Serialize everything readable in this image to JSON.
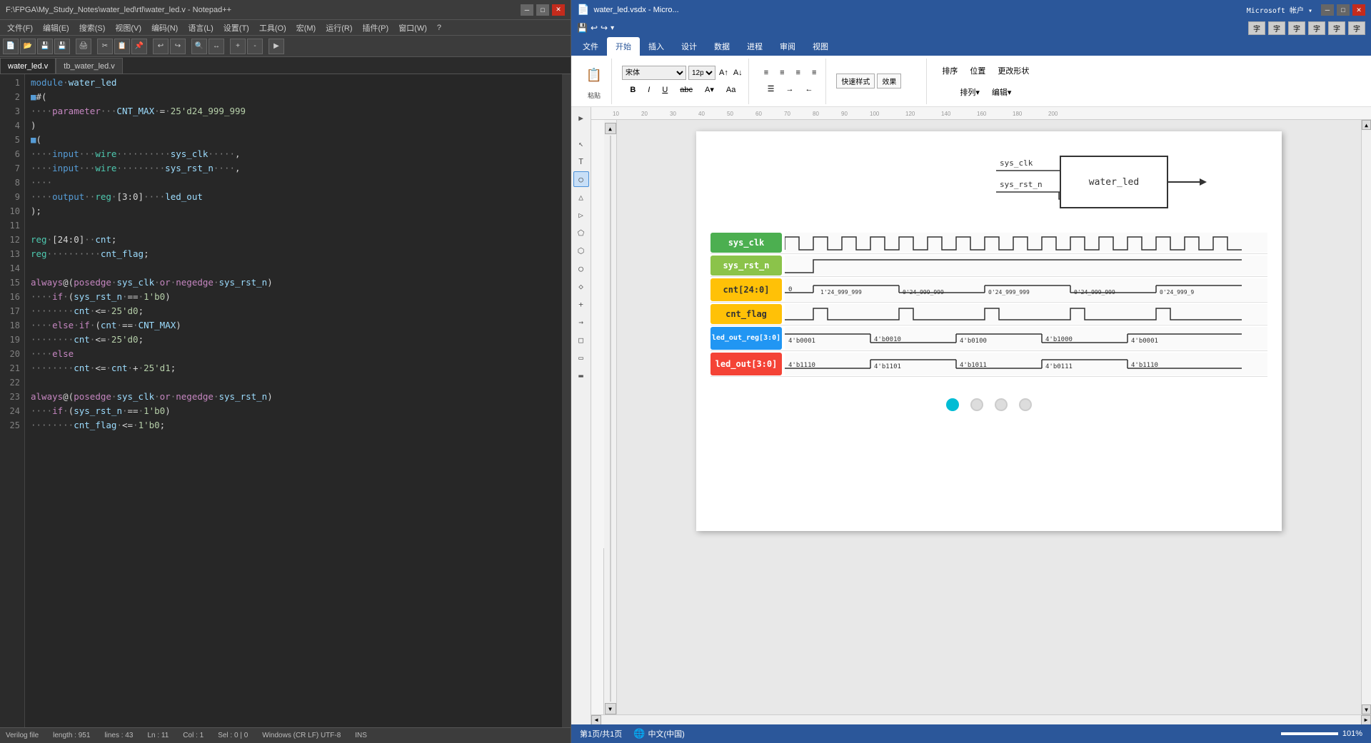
{
  "notepad": {
    "title": "F:\\FPGA\\My_Study_Notes\\water_led\\rtl\\water_led.v - Notepad++",
    "tabs": [
      {
        "label": "water_led.v",
        "active": true
      },
      {
        "label": "tb_water_led.v",
        "active": false
      }
    ],
    "menus": [
      "文件(F)",
      "编辑(E)",
      "搜索(S)",
      "视图(V)",
      "编码(N)",
      "语言(L)",
      "设置(T)",
      "工具(O)",
      "宏(M)",
      "运行(R)",
      "插件(P)",
      "窗口(W)",
      "?"
    ],
    "lines": [
      {
        "num": 1,
        "code": "module·water_led"
      },
      {
        "num": 2,
        "code": "#("
      },
      {
        "num": 3,
        "code": "····parameter···CNT_MAX·=·25'd24_999_999"
      },
      {
        "num": 4,
        "code": ")"
      },
      {
        "num": 5,
        "code": "("
      },
      {
        "num": 6,
        "code": "····input···wire··········sys_clk·····,"
      },
      {
        "num": 7,
        "code": "····input···wire·········sys_rst_n····,"
      },
      {
        "num": 8,
        "code": "····"
      },
      {
        "num": 9,
        "code": "····output··reg·[3:0]····led_out"
      },
      {
        "num": 10,
        "code": ");"
      },
      {
        "num": 11,
        "code": ""
      },
      {
        "num": 12,
        "code": "reg·[24:0]··cnt;"
      },
      {
        "num": 13,
        "code": "reg··········cnt_flag;"
      },
      {
        "num": 14,
        "code": ""
      },
      {
        "num": 15,
        "code": "always@(posedge·sys_clk·or·negedge·sys_rst_n)"
      },
      {
        "num": 16,
        "code": "····if·(sys_rst_n·==·1'b0)"
      },
      {
        "num": 17,
        "code": "········cnt·<=·25'd0;"
      },
      {
        "num": 18,
        "code": "····else·if·(cnt·==·CNT_MAX)"
      },
      {
        "num": 19,
        "code": "········cnt·<=·25'd0;"
      },
      {
        "num": 20,
        "code": "····else"
      },
      {
        "num": 21,
        "code": "········cnt·<=·cnt·+·25'd1;"
      },
      {
        "num": 22,
        "code": ""
      },
      {
        "num": 23,
        "code": "always@(posedge·sys_clk·or·negedge·sys_rst_n)"
      },
      {
        "num": 24,
        "code": "····if·(sys_rst_n·==·1'b0)"
      },
      {
        "num": 25,
        "code": "········cnt_flag·<=·1'b0;"
      }
    ],
    "statusbar": {
      "filetype": "Verilog file",
      "length": "length : 951",
      "lines": "lines : 43",
      "ln": "Ln : 11",
      "col": "Col : 1",
      "sel": "Sel : 0 | 0",
      "encoding": "Windows (CR LF)  UTF-8",
      "mode": "INS"
    }
  },
  "word": {
    "title": "water_led.vsdx - Micro...",
    "ribbon_tabs": [
      "文件",
      "开始",
      "插入",
      "设计",
      "数据",
      "进程",
      "审阅",
      "视图"
    ],
    "active_tab": "开始",
    "font": "宋体",
    "font_size": "12pt",
    "module_name": "water_led",
    "inputs": [
      "sys_clk",
      "sys_rst_n"
    ],
    "output": "→",
    "waveform_rows": [
      {
        "label": "sys_clk",
        "color": "green",
        "type": "clock"
      },
      {
        "label": "sys_rst_n",
        "color": "lime",
        "type": "rst"
      },
      {
        "label": "cnt[24:0]",
        "color": "yellow",
        "type": "data",
        "values": [
          "0",
          "1'24_999_999",
          "0'24_999_999",
          "0'24_999_999",
          "0'24_999_999",
          "0'24_999_9"
        ]
      },
      {
        "label": "cnt_flag",
        "color": "yellow",
        "type": "flag"
      },
      {
        "label": "led_out_reg[3:0]",
        "color": "blue",
        "type": "data",
        "values": [
          "4'b0001",
          "4'b0010",
          "4'b0100",
          "4'b1000",
          "4'b0001"
        ]
      },
      {
        "label": "led_out[3:0]",
        "color": "red",
        "type": "data",
        "values": [
          "4'b1110",
          "4'b1101",
          "4'b1011",
          "4'b0111",
          "4'b1110"
        ]
      }
    ],
    "page_dots": [
      {
        "active": true
      },
      {
        "active": false
      },
      {
        "active": false
      },
      {
        "active": false
      }
    ],
    "statusbar": {
      "page": "第1页/共1页",
      "lang": "中文(中国)",
      "zoom_pct": "101%"
    }
  }
}
